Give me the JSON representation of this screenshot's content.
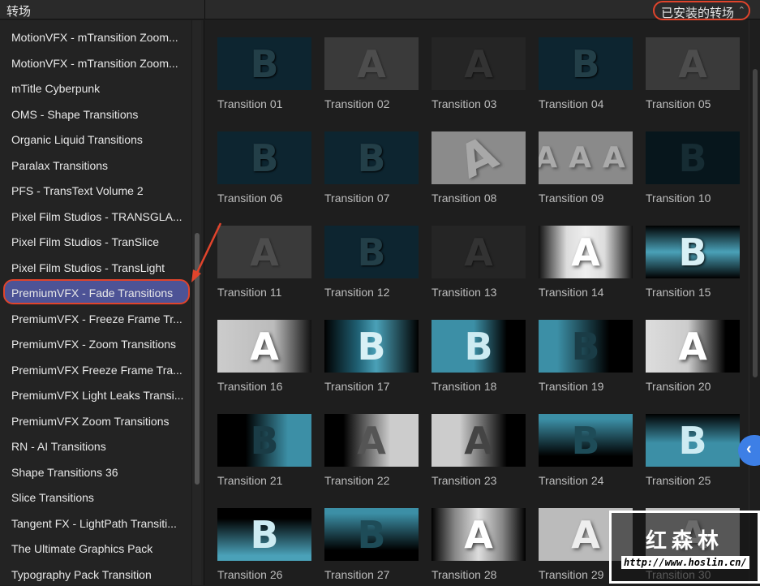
{
  "header": {
    "title": "转场",
    "filter": "已安装的转场",
    "filter_chevron": "⌃"
  },
  "sidebar": {
    "selected_index": 10,
    "items": [
      "MotionVFX - mTransition Zoom...",
      "MotionVFX - mTransition Zoom...",
      "mTitle Cyberpunk",
      "OMS - Shape Transitions",
      "Organic Liquid Transitions",
      "Paralax Transitions",
      "PFS - TransText Volume 2",
      "Pixel Film Studios - TRANSGLA...",
      "Pixel Film Studios - TranSlice",
      "Pixel Film Studios - TransLight",
      "PremiumVFX - Fade Transitions",
      "PremiumVFX - Freeze Frame Tr...",
      "PremiumVFX - Zoom Transitions",
      "PremiumVFX Freeze Frame Tra...",
      "PremiumVFX Light Leaks Transi...",
      "PremiumVFX Zoom Transitions",
      "RN - AI Transitions",
      "Shape Transitions 36",
      "Slice Transitions",
      "Tangent FX - LightPath Transiti...",
      "The Ultimate Graphics Pack",
      "Typography Pack Transition"
    ]
  },
  "transitions": [
    {
      "label": "Transition 01",
      "letter": "B",
      "style": "teal"
    },
    {
      "label": "Transition 02",
      "letter": "A",
      "style": "gray"
    },
    {
      "label": "Transition 03",
      "letter": "A",
      "style": "dark"
    },
    {
      "label": "Transition 04",
      "letter": "B",
      "style": "teal"
    },
    {
      "label": "Transition 05",
      "letter": "A",
      "style": "gray"
    },
    {
      "label": "Transition 06",
      "letter": "B",
      "style": "teal"
    },
    {
      "label": "Transition 07",
      "letter": "B",
      "style": "teal"
    },
    {
      "label": "Transition 08",
      "letter": "A",
      "style": "rot"
    },
    {
      "label": "Transition 09",
      "letter": "AAA",
      "style": "flip"
    },
    {
      "label": "Transition 10",
      "letter": "B",
      "style": "dteal"
    },
    {
      "label": "Transition 11",
      "letter": "A",
      "style": "gray"
    },
    {
      "label": "Transition 12",
      "letter": "B",
      "style": "teal"
    },
    {
      "label": "Transition 13",
      "letter": "A",
      "style": "dark"
    },
    {
      "label": "Transition 14",
      "letter": "A",
      "style": "whc"
    },
    {
      "label": "Transition 15",
      "letter": "B",
      "style": "band"
    },
    {
      "label": "Transition 16",
      "letter": "A",
      "style": "lr"
    },
    {
      "label": "Transition 17",
      "letter": "B",
      "style": "tcen"
    },
    {
      "label": "Transition 18",
      "letter": "B",
      "style": "tl"
    },
    {
      "label": "Transition 19",
      "letter": "B",
      "style": "tl2"
    },
    {
      "label": "Transition 20",
      "letter": "A",
      "style": "ltd"
    },
    {
      "label": "Transition 21",
      "letter": "B",
      "style": "dtr"
    },
    {
      "label": "Transition 22",
      "letter": "A",
      "style": "dlr"
    },
    {
      "label": "Transition 23",
      "letter": "A",
      "style": "ldr"
    },
    {
      "label": "Transition 24",
      "letter": "B",
      "style": "ttb"
    },
    {
      "label": "Transition 25",
      "letter": "B",
      "style": "dtt"
    },
    {
      "label": "Transition 26",
      "letter": "B",
      "style": "dtb"
    },
    {
      "label": "Transition 27",
      "letter": "B",
      "style": "ttb"
    },
    {
      "label": "Transition 28",
      "letter": "A",
      "style": "wc2"
    },
    {
      "label": "Transition 29",
      "letter": "A",
      "style": "lt"
    },
    {
      "label": "Transition 30",
      "letter": "A",
      "style": "lt"
    }
  ],
  "collapse_icon": "‹",
  "watermark": {
    "text": "红森林",
    "url": "http://www.hoslin.cn/"
  }
}
